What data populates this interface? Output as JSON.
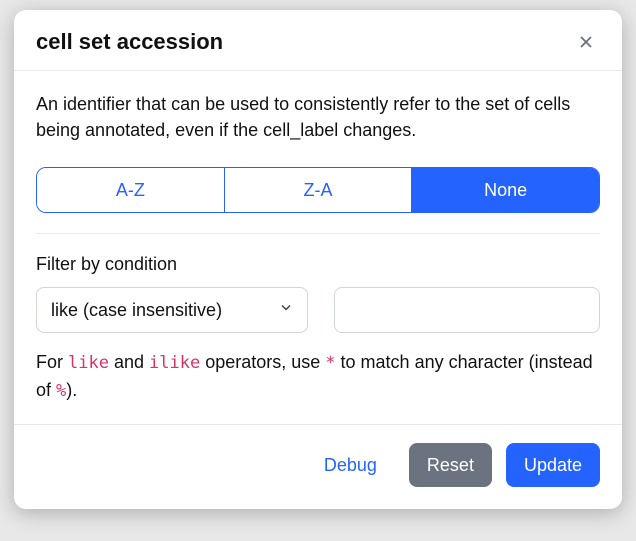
{
  "modal": {
    "title": "cell set accession",
    "description": "An identifier that can be used to consistently refer to the set of cells being annotated, even if the cell_label changes."
  },
  "sort": {
    "options": [
      "A-Z",
      "Z-A",
      "None"
    ],
    "selected_index": 2
  },
  "filter": {
    "label": "Filter by condition",
    "operator_selected": "like (case insensitive)",
    "value": "",
    "helper_prefix": "For ",
    "helper_code1": "like",
    "helper_mid1": " and ",
    "helper_code2": "ilike",
    "helper_mid2": " operators, use ",
    "helper_code3": "*",
    "helper_mid3": " to match any character (instead of ",
    "helper_code4": "%",
    "helper_suffix": ")."
  },
  "footer": {
    "debug": "Debug",
    "reset": "Reset",
    "update": "Update"
  }
}
